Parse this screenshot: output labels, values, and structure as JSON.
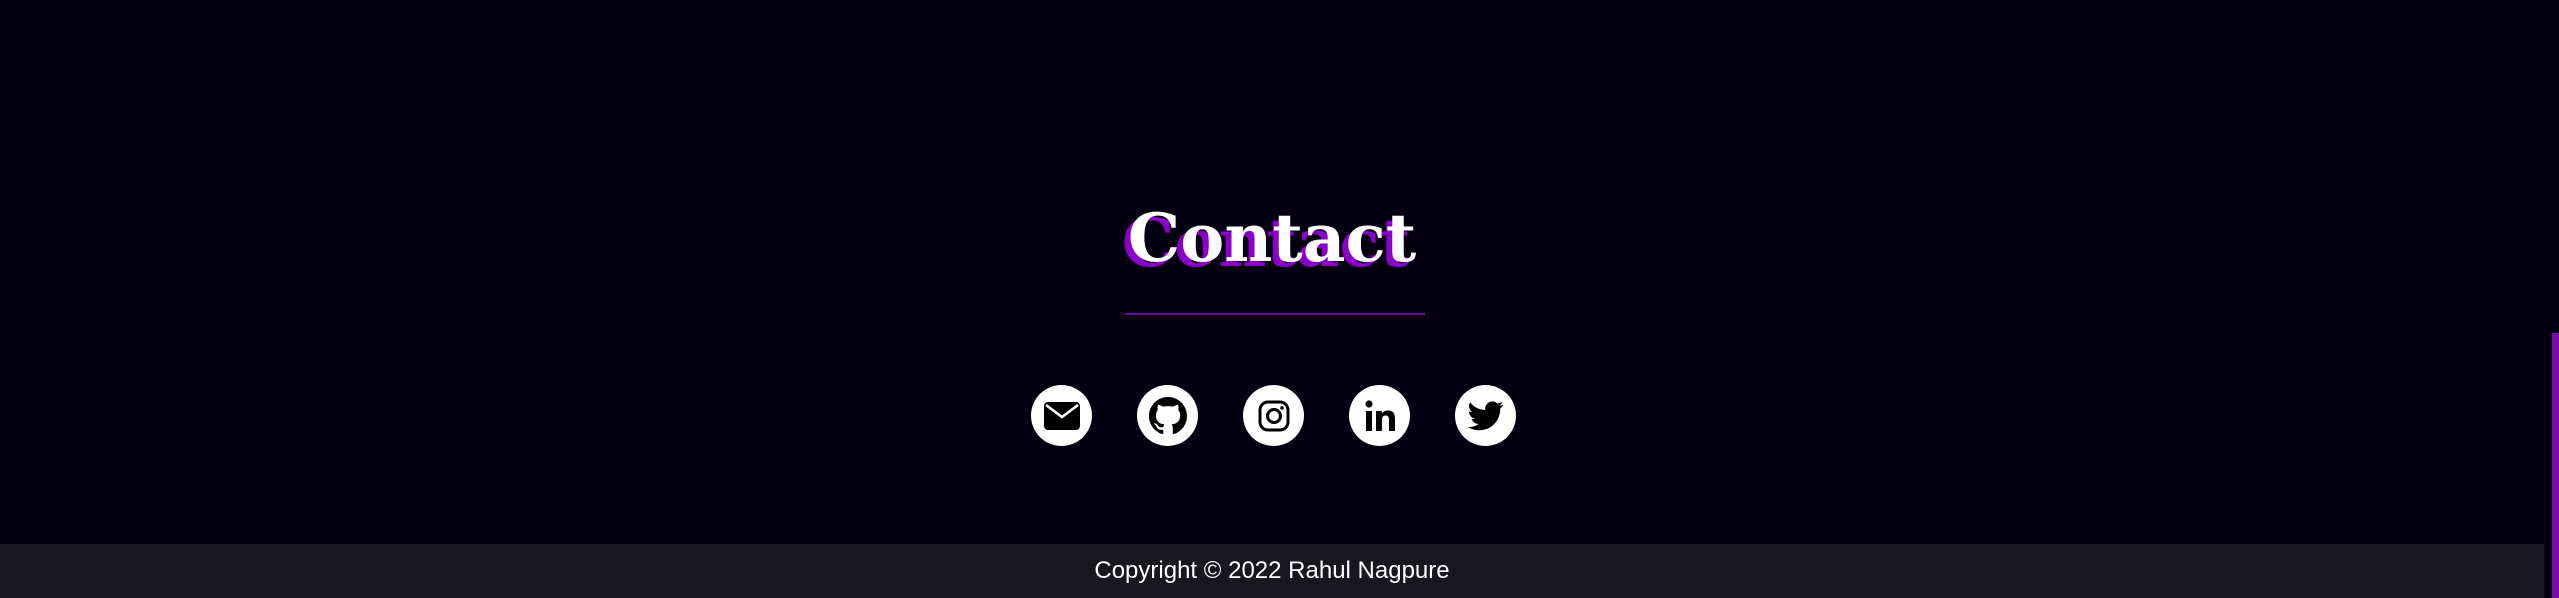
{
  "contact": {
    "title": "Contact",
    "links": [
      {
        "name": "email",
        "icon": "envelope-icon"
      },
      {
        "name": "github",
        "icon": "github-icon"
      },
      {
        "name": "instagram",
        "icon": "instagram-icon"
      },
      {
        "name": "linkedin",
        "icon": "linkedin-icon"
      },
      {
        "name": "twitter",
        "icon": "twitter-icon"
      }
    ]
  },
  "footer": {
    "copyright": "Copyright © 2022 Rahul Nagpure"
  },
  "colors": {
    "background": "#050011",
    "accent": "#8b00c9",
    "footer_bg": "#18161f",
    "text": "#ffffff"
  }
}
